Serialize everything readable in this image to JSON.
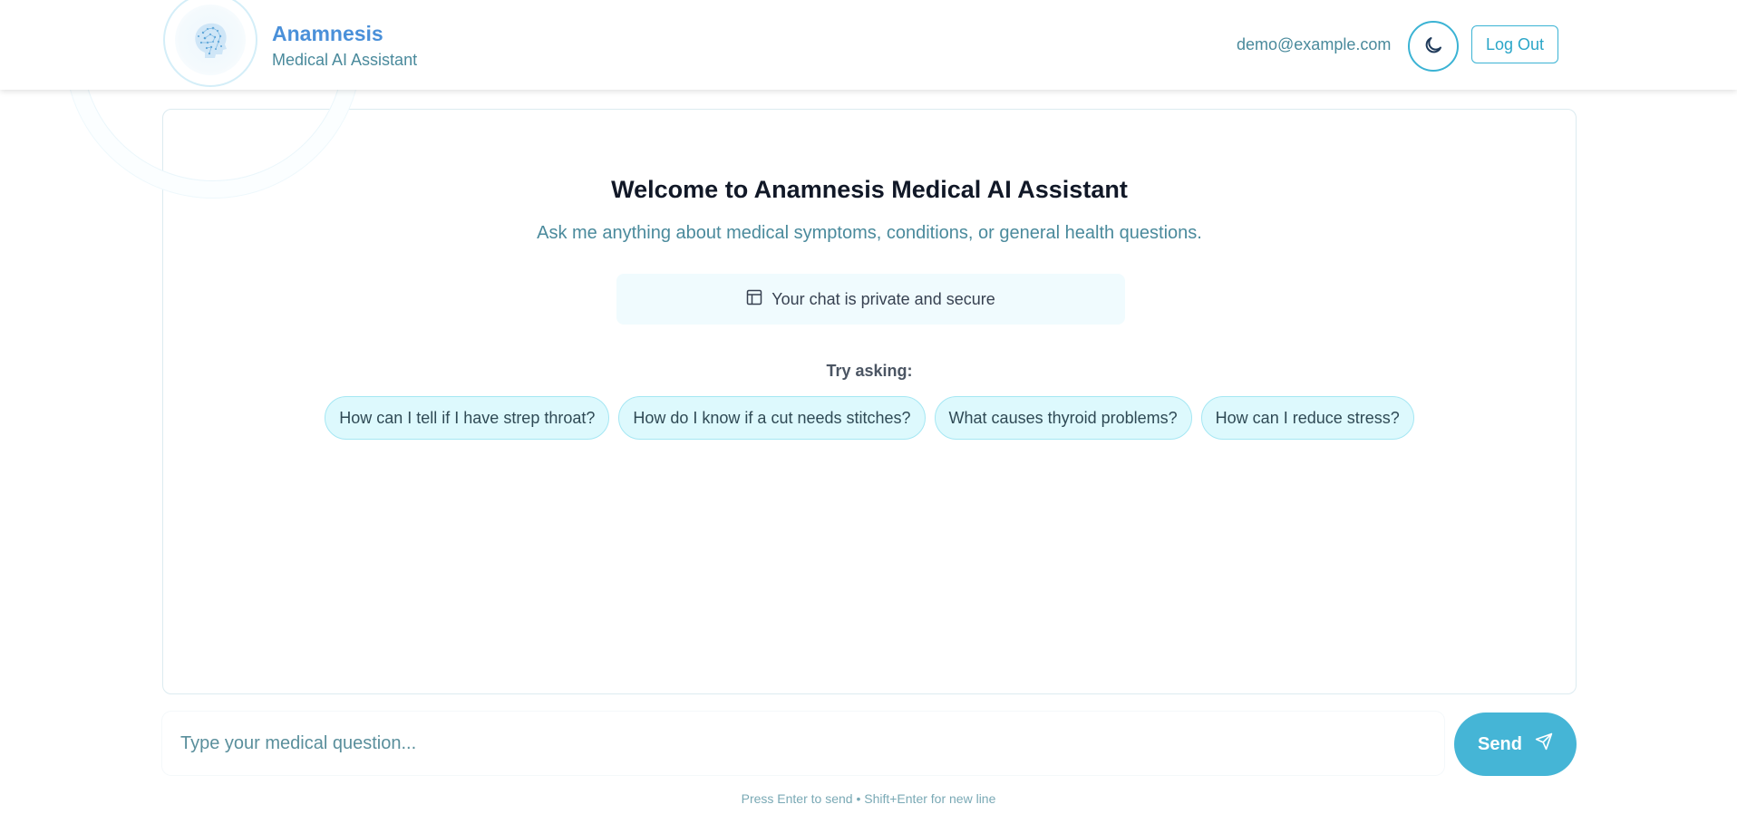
{
  "brand": {
    "title": "Anamnesis",
    "subtitle": "Medical AI Assistant",
    "logo_icon": "brain-head-icon"
  },
  "header": {
    "user_email": "demo@example.com",
    "theme_icon": "moon-icon",
    "logout_label": "Log Out"
  },
  "welcome": {
    "title": "Welcome to Anamnesis Medical AI Assistant",
    "subtitle": "Ask me anything about medical symptoms, conditions, or general health questions.",
    "privacy_icon": "layout-panel-icon",
    "privacy_text": "Your chat is private and secure"
  },
  "suggestions": {
    "label": "Try asking:",
    "items": [
      "How can I tell if I have strep throat?",
      "How do I know if a cut needs stitches?",
      "What causes thyroid problems?",
      "How can I reduce stress?"
    ]
  },
  "composer": {
    "placeholder": "Type your medical question...",
    "value": "",
    "send_label": "Send",
    "send_icon": "paper-plane-icon",
    "hint": "Press Enter to send • Shift+Enter for new line"
  },
  "colors": {
    "brand_blue": "#4a90d9",
    "accent_teal": "#45b5d6",
    "chip_bg": "#ddf9fd",
    "muted_text": "#4a8a9c"
  }
}
